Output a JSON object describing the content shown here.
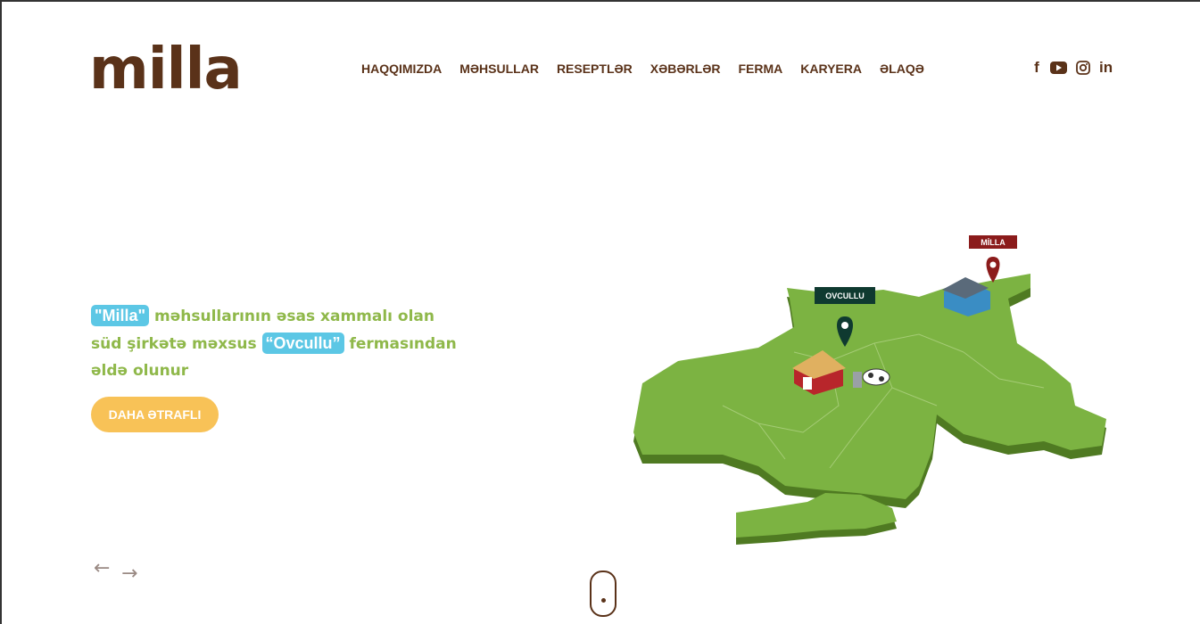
{
  "brand": {
    "logo_text": "milla"
  },
  "nav": {
    "items": [
      {
        "label": "HAQQIMIZDA"
      },
      {
        "label": "MƏHSULLAR"
      },
      {
        "label": "RESEPTLƏR"
      },
      {
        "label": "XƏBƏRLƏR"
      },
      {
        "label": "FERMA"
      },
      {
        "label": "KARYERA"
      },
      {
        "label": "ƏLAQƏ"
      }
    ]
  },
  "social": {
    "facebook": "f",
    "youtube": "youtube-icon",
    "instagram": "instagram-icon",
    "linkedin": "in"
  },
  "hero": {
    "highlight_1": "\"Milla\"",
    "text_1": " məhsullarının əsas xammalı olan",
    "text_2": "süd şirkətə məxsus ",
    "highlight_2": "“Ovcullu”",
    "text_3": "  fermasından",
    "text_4": "əldə olunur",
    "button_label": "DAHA ƏTRAFLI"
  },
  "slider": {
    "prev": "←",
    "next": "→"
  },
  "map": {
    "label_farm": "OVCULLU",
    "label_factory": "MİLLA"
  },
  "colors": {
    "brand_brown": "#5a3219",
    "hero_green": "#8fb84a",
    "highlight_blue": "#5cc7e5",
    "button_yellow": "#f8c257",
    "map_green": "#7cb342",
    "label_dark_green": "#0f3a30",
    "label_dark_red": "#8b1b1b"
  }
}
